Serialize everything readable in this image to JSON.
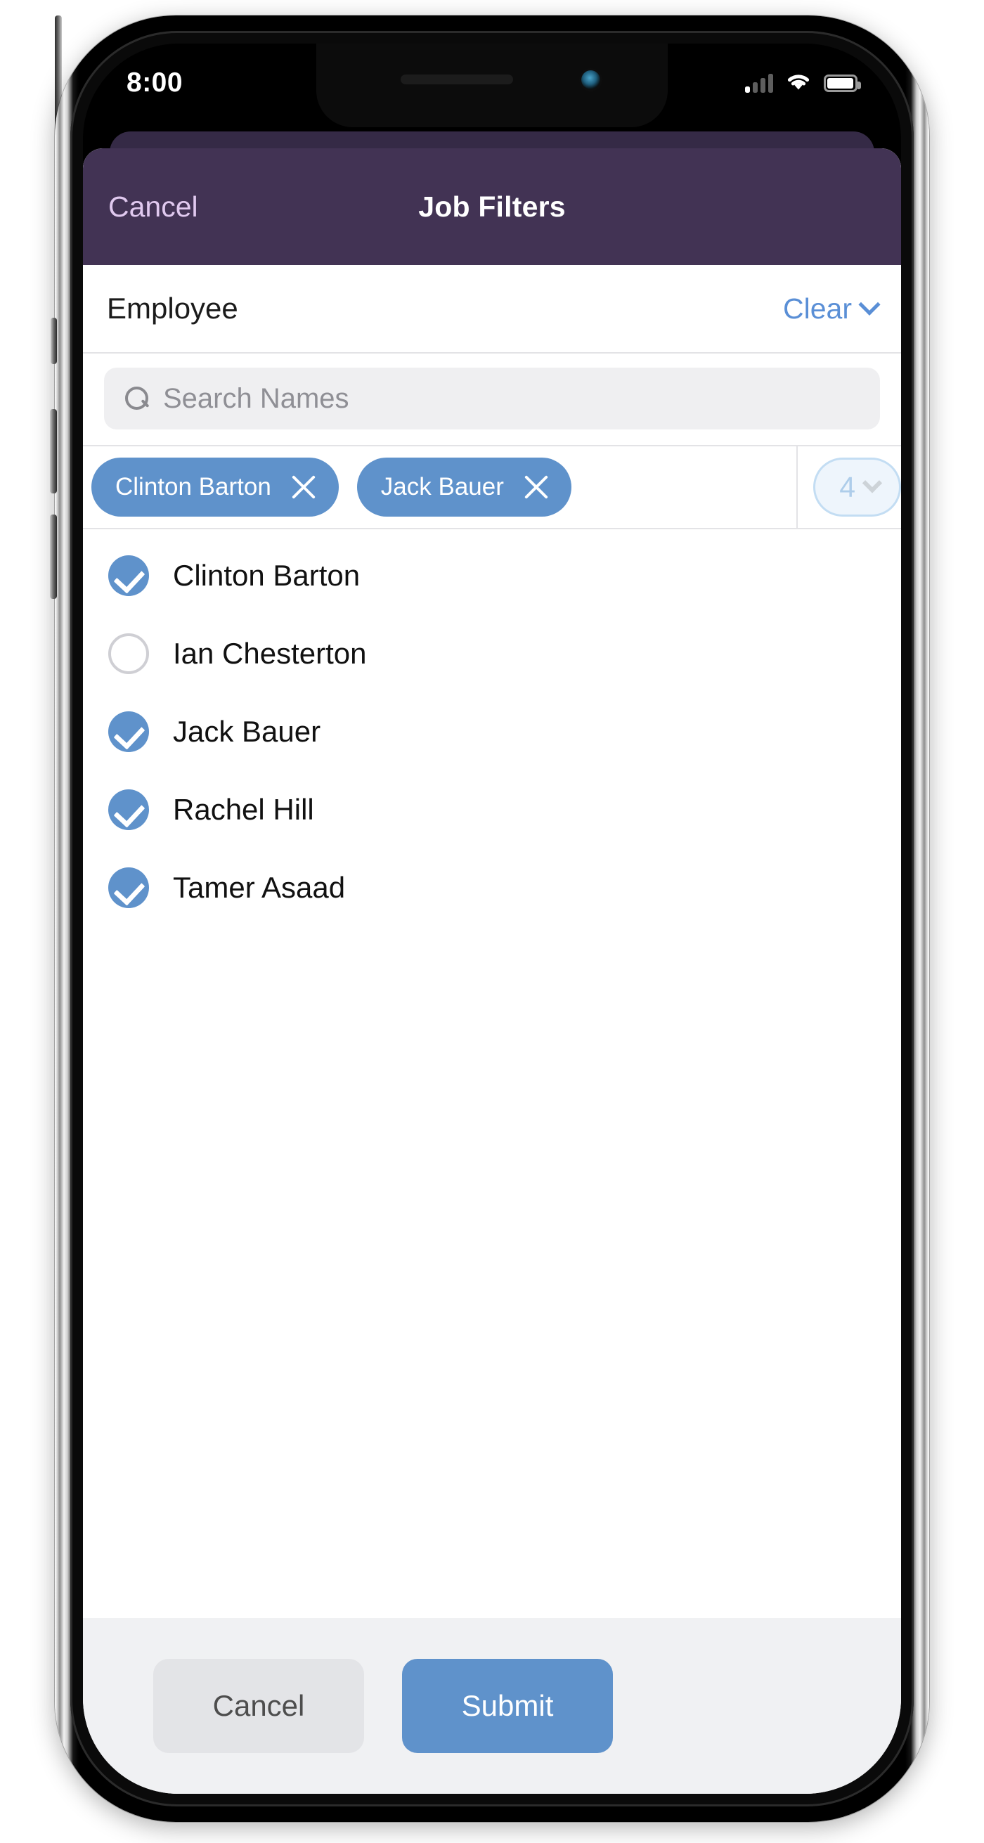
{
  "status_bar": {
    "time": "8:00",
    "signal_icon": "cellular-signal-icon",
    "wifi_icon": "wifi-icon",
    "battery_icon": "battery-full-icon"
  },
  "sheet": {
    "cancel_label": "Cancel",
    "title": "Job Filters"
  },
  "section": {
    "label": "Employee",
    "clear_label": "Clear",
    "clear_chevron_icon": "chevron-down-icon"
  },
  "search": {
    "placeholder": "Search Names",
    "value": "",
    "icon": "search-icon"
  },
  "chips": [
    {
      "label": "Clinton Barton",
      "remove_icon": "close-x-icon"
    },
    {
      "label": "Jack Bauer",
      "remove_icon": "close-x-icon"
    }
  ],
  "count_pill": {
    "value": "4",
    "chevron_icon": "chevron-down-icon"
  },
  "names": [
    {
      "label": "Clinton Barton",
      "checked": true,
      "icon": "check-circle-filled-icon"
    },
    {
      "label": "Ian Chesterton",
      "checked": false,
      "icon": "circle-outline-icon"
    },
    {
      "label": "Jack Bauer",
      "checked": true,
      "icon": "check-circle-filled-icon"
    },
    {
      "label": "Rachel Hill",
      "checked": true,
      "icon": "check-circle-filled-icon"
    },
    {
      "label": "Tamer Asaad",
      "checked": true,
      "icon": "check-circle-filled-icon"
    }
  ],
  "footer": {
    "cancel_label": "Cancel",
    "submit_label": "Submit"
  },
  "colors": {
    "header_purple": "#423354",
    "backdrop_purple": "#352a46",
    "accent_blue": "#5f92cb",
    "link_blue": "#5a8fd6",
    "cancel_link_lavender": "#e0c9ef",
    "footer_gray": "#f0f1f3",
    "search_gray": "#efeff1",
    "pill_light_blue": "#eef5fc"
  }
}
